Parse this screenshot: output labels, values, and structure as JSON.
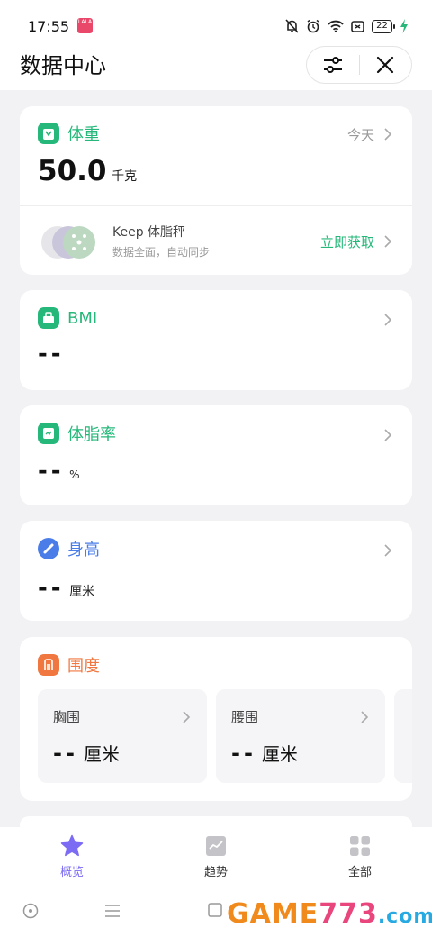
{
  "status_bar": {
    "time": "17:55",
    "app_badge_text": "LALA",
    "battery": "22"
  },
  "header": {
    "title": "数据中心"
  },
  "weight_card": {
    "title": "体重",
    "date_label": "今天",
    "value": "50.0",
    "unit": "千克",
    "scale_name": "Keep 体脂秤",
    "scale_desc": "数据全面，自动同步",
    "get_now": "立即获取"
  },
  "bmi_card": {
    "title": "BMI",
    "value": "--"
  },
  "bodyfat_card": {
    "title": "体脂率",
    "value": "--",
    "unit": "%"
  },
  "height_card": {
    "title": "身高",
    "value": "--",
    "unit": "厘米"
  },
  "girth_card": {
    "title": "围度",
    "items": [
      {
        "label": "胸围",
        "value": "--",
        "unit": "厘米"
      },
      {
        "label": "腰围",
        "value": "--",
        "unit": "厘米"
      }
    ]
  },
  "tabs": [
    {
      "label": "概览",
      "active": true
    },
    {
      "label": "趋势",
      "active": false
    },
    {
      "label": "全部",
      "active": false
    }
  ],
  "watermark": {
    "part1": "GAME",
    "part2": "773",
    "part3": ".com"
  },
  "colors": {
    "green": "#26b87a",
    "blue": "#4a7de8",
    "orange": "#f07840",
    "purple": "#7b6cf3"
  },
  "icons": [
    "bell-off-icon",
    "alarm-icon",
    "wifi-icon",
    "screen-icon",
    "battery-icon",
    "charging-icon",
    "filter-icon",
    "close-icon",
    "chevron-right-icon",
    "star-icon",
    "trend-icon",
    "grid-icon"
  ]
}
